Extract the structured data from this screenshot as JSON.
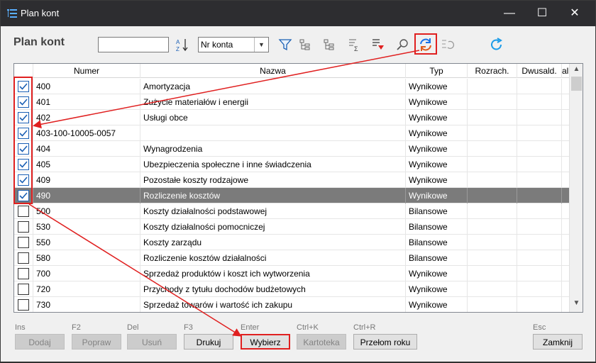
{
  "window": {
    "title": "Plan kont",
    "minimize": "—",
    "maximize": "☐",
    "close": "✕"
  },
  "header": {
    "title": "Plan kont",
    "search_value": "",
    "sort_select": "Nr konta"
  },
  "colors": {
    "accent": "#e02020",
    "selected_row": "#7b7b7b",
    "check": "#1a5fb4"
  },
  "grid": {
    "columns": [
      "Numer",
      "Nazwa",
      "Typ",
      "Rozrach.",
      "Dwusald.",
      "al"
    ],
    "rows": [
      {
        "checked": true,
        "numer": "400",
        "nazwa": "Amortyzacja",
        "typ": "Wynikowe"
      },
      {
        "checked": true,
        "numer": "401",
        "nazwa": "Zużycie materiałów i energii",
        "typ": "Wynikowe"
      },
      {
        "checked": true,
        "numer": "402",
        "nazwa": "Usługi obce",
        "typ": "Wynikowe"
      },
      {
        "checked": true,
        "numer": "403-100-10005-0057",
        "nazwa": "",
        "typ": "Wynikowe"
      },
      {
        "checked": true,
        "numer": "404",
        "nazwa": "Wynagrodzenia",
        "typ": "Wynikowe"
      },
      {
        "checked": true,
        "numer": "405",
        "nazwa": "Ubezpieczenia społeczne i inne świadczenia",
        "typ": "Wynikowe"
      },
      {
        "checked": true,
        "numer": "409",
        "nazwa": "Pozostałe koszty rodzajowe",
        "typ": "Wynikowe"
      },
      {
        "checked": true,
        "numer": "490",
        "nazwa": "Rozliczenie kosztów",
        "typ": "Wynikowe",
        "selected": true
      },
      {
        "checked": false,
        "numer": "500",
        "nazwa": "Koszty działalności podstawowej",
        "typ": "Bilansowe"
      },
      {
        "checked": false,
        "numer": "530",
        "nazwa": "Koszty działalności pomocniczej",
        "typ": "Bilansowe"
      },
      {
        "checked": false,
        "numer": "550",
        "nazwa": "Koszty zarządu",
        "typ": "Bilansowe"
      },
      {
        "checked": false,
        "numer": "580",
        "nazwa": "Rozliczenie kosztów działalności",
        "typ": "Bilansowe"
      },
      {
        "checked": false,
        "numer": "700",
        "nazwa": "Sprzedaż produktów i koszt ich wytworzenia",
        "typ": "Wynikowe"
      },
      {
        "checked": false,
        "numer": "720",
        "nazwa": "Przychody z tytułu dochodów budżetowych",
        "typ": "Wynikowe"
      },
      {
        "checked": false,
        "numer": "730",
        "nazwa": "Sprzedaż towarów i wartość ich zakupu",
        "typ": "Wynikowe"
      }
    ]
  },
  "footer": {
    "shortcuts": [
      "Ins",
      "F2",
      "Del",
      "F3",
      "Enter",
      "Ctrl+K",
      "Ctrl+R",
      "Esc"
    ],
    "buttons": {
      "dodaj": "Dodaj",
      "popraw": "Popraw",
      "usun": "Usuń",
      "drukuj": "Drukuj",
      "wybierz": "Wybierz",
      "kartoteka": "Kartoteka",
      "przelom": "Przełom roku",
      "zamknij": "Zamknij"
    }
  },
  "icons": [
    "app-icon",
    "sort-az-icon",
    "filter-icon",
    "expand-tree-icon",
    "collapse-tree-icon",
    "sum-icon",
    "filter-sum-icon",
    "search-icon",
    "refresh-arrows-icon",
    "refresh-list-icon",
    "reload-icon"
  ]
}
